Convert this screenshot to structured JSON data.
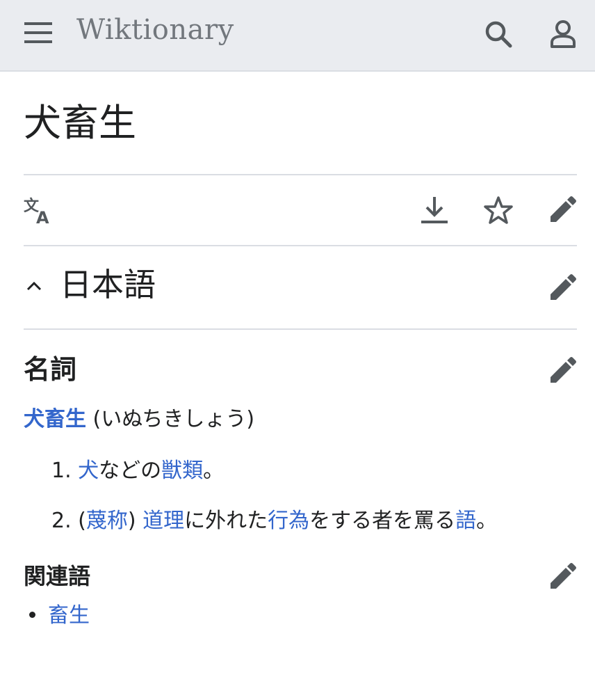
{
  "header": {
    "menu_icon": "hamburger-menu-icon",
    "site_name": "Wiktionary",
    "search_icon": "search-icon",
    "user_icon": "user-icon"
  },
  "page": {
    "title": "犬畜生"
  },
  "actions": {
    "language_icon": "translate-icon",
    "download_icon": "download-icon",
    "watch_icon": "star-icon",
    "edit_icon": "pencil-icon"
  },
  "section": {
    "language_heading": "日本語",
    "collapse_icon": "chevron-up-icon"
  },
  "noun": {
    "heading": "名詞",
    "headword": "犬畜生",
    "reading": "(いぬちきしょう)",
    "definitions": [
      {
        "num": "1.",
        "parts": [
          {
            "text": "犬",
            "link": true
          },
          {
            "text": "などの",
            "link": false
          },
          {
            "text": "獣類",
            "link": true
          },
          {
            "text": "。",
            "link": false
          }
        ]
      },
      {
        "num": "2.",
        "parts": [
          {
            "text": "(",
            "link": false
          },
          {
            "text": "蔑称",
            "link": true
          },
          {
            "text": ") ",
            "link": false
          },
          {
            "text": "道理",
            "link": true
          },
          {
            "text": "に外れた",
            "link": false
          },
          {
            "text": "行為",
            "link": true
          },
          {
            "text": "をする者を罵る",
            "link": false
          },
          {
            "text": "語",
            "link": true
          },
          {
            "text": "。",
            "link": false
          }
        ]
      }
    ]
  },
  "related": {
    "heading": "関連語",
    "items": [
      "畜生"
    ]
  },
  "colors": {
    "link": "#3366cc",
    "header_bg": "#eaecf0",
    "text": "#202122",
    "icon": "#54595d"
  }
}
